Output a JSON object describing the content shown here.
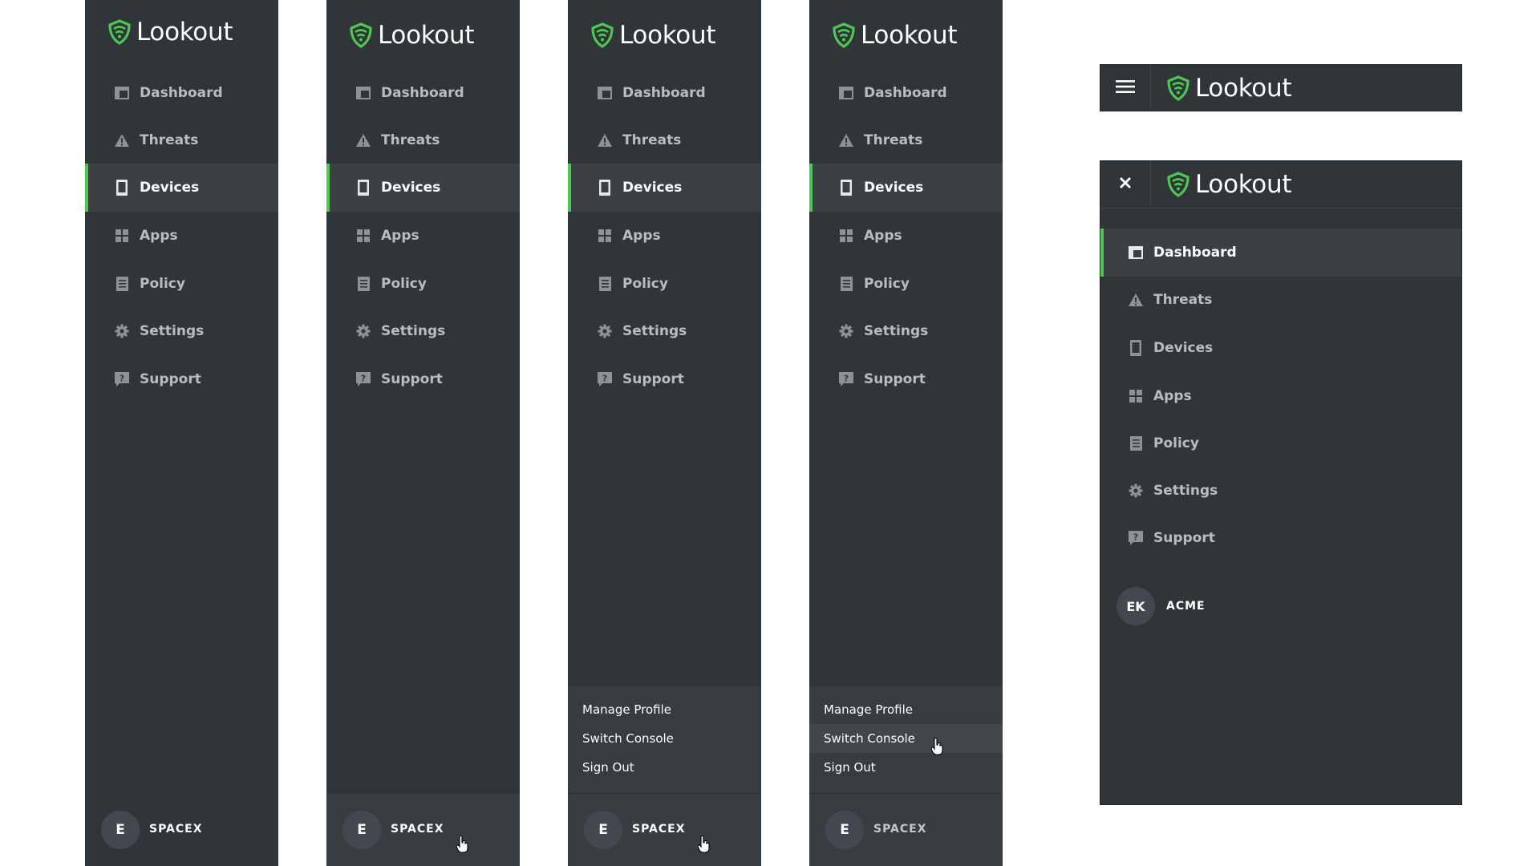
{
  "brand": {
    "name": "Lookout",
    "accent": "#4ec853",
    "icon": "lookout-shield-icon"
  },
  "nav": [
    {
      "label": "Dashboard",
      "icon": "dashboard-icon"
    },
    {
      "label": "Threats",
      "icon": "warning-icon"
    },
    {
      "label": "Devices",
      "icon": "device-icon"
    },
    {
      "label": "Apps",
      "icon": "apps-grid-icon"
    },
    {
      "label": "Policy",
      "icon": "policy-icon"
    },
    {
      "label": "Settings",
      "icon": "gear-icon"
    },
    {
      "label": "Support",
      "icon": "help-icon"
    }
  ],
  "panels": [
    {
      "state": "default",
      "active": "Devices",
      "avatar": "E",
      "org": "SPACEX"
    },
    {
      "state": "account-hover",
      "active": "Devices",
      "avatar": "E",
      "org": "SPACEX"
    },
    {
      "state": "menu-open",
      "active": "Devices",
      "avatar": "E",
      "org": "SPACEX"
    },
    {
      "state": "menu-item-hover",
      "active": "Devices",
      "avatar": "E",
      "org": "SPACEX",
      "hover_item": "Switch Console"
    }
  ],
  "account_menu": [
    "Manage Profile",
    "Switch Console",
    "Sign Out"
  ],
  "mobile": {
    "collapsed_button_icon": "hamburger-menu-icon",
    "expanded_button_icon": "close-icon",
    "active": "Dashboard",
    "avatar": "EK",
    "org": "ACME"
  }
}
